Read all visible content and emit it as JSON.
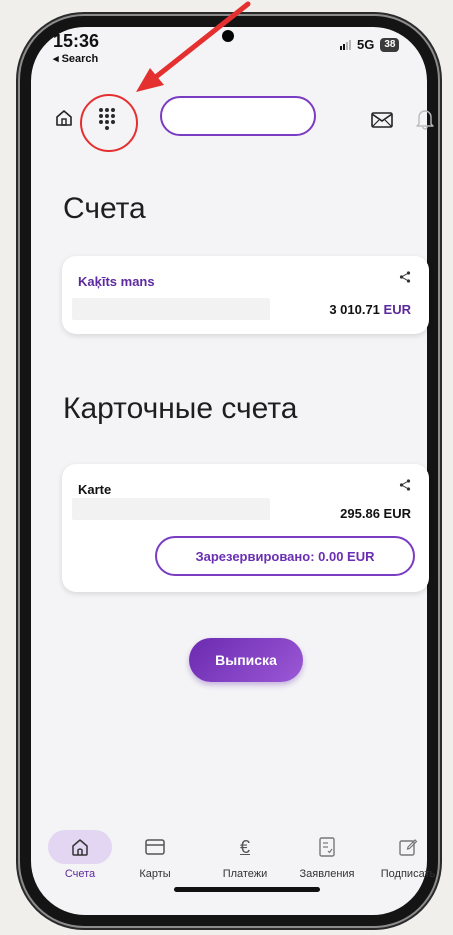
{
  "status": {
    "time": "15:36",
    "back": "◂ Search",
    "network": "5G",
    "battery": "38"
  },
  "header": {
    "search_placeholder": ""
  },
  "accounts": {
    "title": "Счета",
    "card": {
      "name": "Kaķīts mans",
      "amount": "3 010.71",
      "currency": "EUR"
    }
  },
  "card_accounts": {
    "title": "Карточные счета",
    "card": {
      "name": "Karte",
      "amount": "295.86 EUR",
      "reserved": "Зарезервировано: 0.00 EUR"
    }
  },
  "statement_button": "Выписка",
  "tabs": [
    {
      "label": "Счета",
      "icon": "home-icon",
      "active": true
    },
    {
      "label": "Карты",
      "icon": "card-icon",
      "active": false
    },
    {
      "label": "Платежи",
      "icon": "euro-icon",
      "active": false
    },
    {
      "label": "Заявления",
      "icon": "document-icon",
      "active": false
    },
    {
      "label": "Подписать",
      "icon": "sign-icon",
      "active": false
    }
  ],
  "colors": {
    "accent": "#6b2bb0",
    "annotation": "#e53030"
  }
}
